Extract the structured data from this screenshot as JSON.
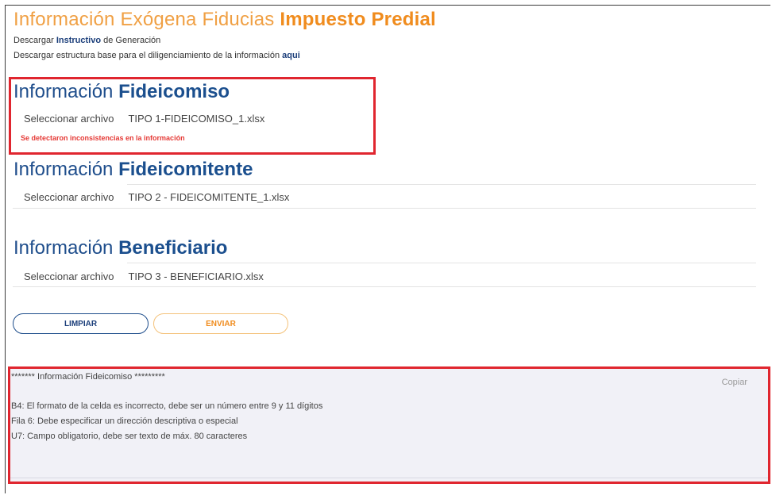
{
  "header": {
    "title_light": "Información Exógena Fiducias",
    "title_bold": "Impuesto Predial",
    "download_line1": {
      "prefix": "Descargar",
      "link": "Instructivo",
      "suffix": "de Generación"
    },
    "download_line2": {
      "prefix": "Descargar estructura base para el diligenciamiento de la información",
      "link": "aqui"
    }
  },
  "sections": [
    {
      "title_light": "Información",
      "title_bold": "Fideicomiso",
      "select_label": "Seleccionar archivo",
      "file_name": "TIPO 1-FIDEICOMISO_1.xlsx",
      "error": "Se detectaron inconsistencias en la información"
    },
    {
      "title_light": "Información",
      "title_bold": "Fideicomitente",
      "select_label": "Seleccionar archivo",
      "file_name": "TIPO 2 - FIDEICOMITENTE_1.xlsx"
    },
    {
      "title_light": "Información",
      "title_bold": "Beneficiario",
      "select_label": "Seleccionar archivo",
      "file_name": "TIPO 3 - BENEFICIARIO.xlsx"
    }
  ],
  "actions": {
    "clear_label": "LIMPIAR",
    "send_label": "ENVIAR"
  },
  "console": {
    "header": "******* Información Fideicomiso *********",
    "copy_label": "Copiar",
    "lines": [
      "B4: El formato de la celda es incorrecto, debe ser un número entre 9 y 11 dígitos",
      "Fila 6: Debe especificar un dirección descriptiva o especial",
      "U7: Campo obligatorio, debe ser texto de máx. 80 caracteres"
    ]
  },
  "colors": {
    "accent_orange": "#f08c1e",
    "primary_blue": "#1b4f8e",
    "error_red": "#e53935",
    "highlight_red": "#e0262f",
    "console_bg": "#f1f1f7"
  }
}
